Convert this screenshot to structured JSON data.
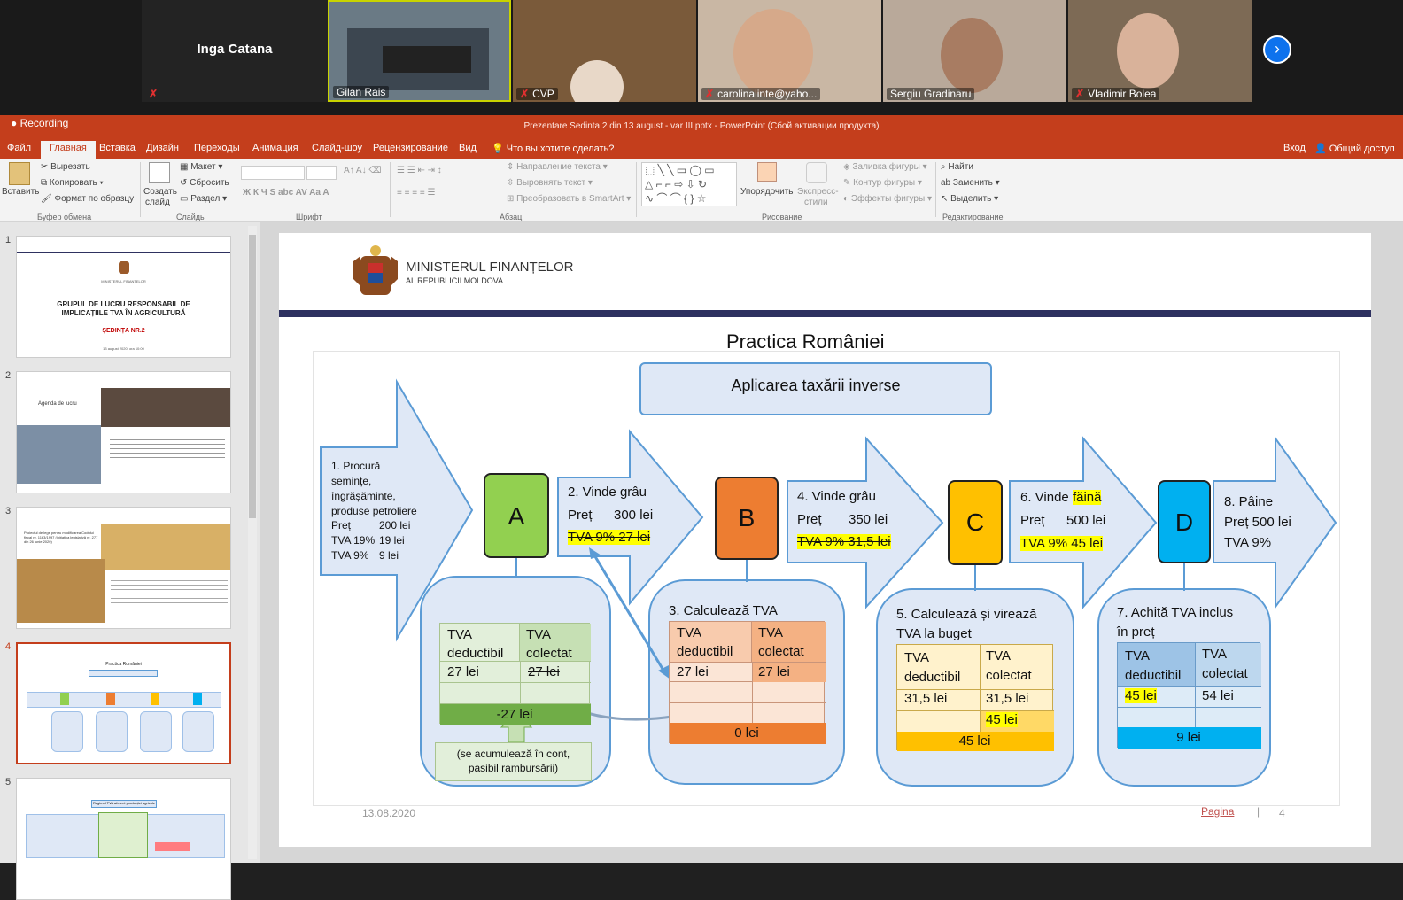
{
  "zoom": {
    "participants": [
      {
        "name": "Inga Catana"
      },
      {
        "name": "Gilan Rais"
      },
      {
        "name": "CVP"
      },
      {
        "name": "carolinalinte@yaho..."
      },
      {
        "name": "Sergiu Gradinaru"
      },
      {
        "name": "Vladimir Bolea"
      }
    ],
    "next_icon": "chevron-right-icon"
  },
  "titlebar": {
    "recording": "Recording",
    "title": "Prezentare Sedinta 2 din 13 august - var III.pptx - PowerPoint (Сбой активации продукта)"
  },
  "menu": {
    "items": [
      "Файл",
      "Главная",
      "Вставка",
      "Дизайн",
      "Переходы",
      "Анимация",
      "Слайд-шоу",
      "Рецензирование",
      "Вид"
    ],
    "tell": "Что вы хотите сделать?",
    "login": "Вход",
    "share": "Общий доступ"
  },
  "ribbon": {
    "paste": "Вставить",
    "cut": "Вырезать",
    "copy": "Копировать",
    "format_painter": "Формат по образцу",
    "clipboard": "Буфер обмена",
    "new_slide_1": "Создать",
    "new_slide_2": "слайд",
    "layout": "Макет",
    "reset": "Сбросить",
    "section": "Раздел",
    "slides": "Слайды",
    "font": "Шрифт",
    "text_direction": "Направление текста",
    "align_text": "Выровнять текст",
    "smartart": "Преобразовать в SmartArt",
    "paragraph": "Абзац",
    "arrange": "Упорядочить",
    "quick_styles_1": "Экспресс-",
    "quick_styles_2": "стили",
    "fill": "Заливка фигуры",
    "outline": "Контур фигуры",
    "effects": "Эффекты фигуры",
    "drawing": "Рисование",
    "find": "Найти",
    "replace": "Заменить",
    "select": "Выделить",
    "editing": "Редактирование"
  },
  "thumbs": [
    {
      "num": "1",
      "line1": "MINISTERUL FINANȚELOR",
      "line2": "GRUPUL DE LUCRU RESPONSABIL DE",
      "line3": "IMPLICAȚIILE TVA ÎN AGRICULTURĂ",
      "line4": "ȘEDINȚA NR.2",
      "line5": "13 august 2020, ora 10:00"
    },
    {
      "num": "2",
      "title": "Agenda de lucru"
    },
    {
      "num": "3",
      "title": "Proiectul de lege pentru modificarea Codului fiscal nr. 1163/1997 (inițiativa legislativă nr. 277 din 26 iunie 2020)"
    },
    {
      "num": "4",
      "title": "Practica României"
    },
    {
      "num": "5",
      "title": "Regimul TVA aferent producției agricole"
    }
  ],
  "slide": {
    "org1": "MINISTERUL FINANȚELOR",
    "org2": "AL REPUBLICII MOLDOVA",
    "title": "Practica României",
    "banner": "Aplicarea taxării inverse",
    "step1": [
      "1.    Procură",
      "semințe,",
      "îngrășăminte,",
      "produse petroliere"
    ],
    "step1_prices": [
      {
        "label": "Preț",
        "value": "200 lei"
      },
      {
        "label": "TVA 19%",
        "value": "19 lei"
      },
      {
        "label": "TVA 9%",
        "value": "9 lei"
      }
    ],
    "nodes": [
      "A",
      "B",
      "C",
      "D"
    ],
    "step2": {
      "title": "2. Vinde grâu",
      "price_label": "Preț",
      "price_value": "300 lei",
      "vat": "TVA 9% 27 lei"
    },
    "step4": {
      "title": "4. Vinde grâu",
      "price_label": "Preț",
      "price_value": "350 lei",
      "vat": "TVA 9% 31,5 lei"
    },
    "step6": {
      "title": "6. Vinde",
      "title_hl": "făină",
      "price_label": "Preț",
      "price_value": "500 lei",
      "vat": "TVA 9% 45 lei"
    },
    "step8": {
      "title": "8.      Pâine",
      "price": "Preț 500 lei",
      "vat": "TVA 9%"
    },
    "boxA": {
      "h1": "TVA deductibil",
      "h2": "TVA colectat",
      "v1": "27 lei",
      "v2": "27 lei",
      "total": "-27 lei",
      "note": "(se acumulează în cont, pasibil rambursării)"
    },
    "boxB": {
      "title": "3. Calculează TVA",
      "h1": "TVA deductibil",
      "h2": "TVA colectat",
      "v1": "27 lei",
      "v2": "27 lei",
      "total": "0 lei"
    },
    "boxC": {
      "title1": "5. Calculează și virează",
      "title2": "TVA la buget",
      "h1": "TVA deductibil",
      "h2": "TVA colectat",
      "v1": "31,5 lei",
      "v2": "31,5 lei",
      "v3": "45 lei",
      "total": "45 lei"
    },
    "boxD": {
      "title1": "7. Achită TVA inclus",
      "title2": "în preț",
      "h1": "TVA deductibil",
      "h2": "TVA colectat",
      "v1": "45 lei",
      "v2": "54 lei",
      "total": "9 lei"
    },
    "footer_date": "13.08.2020",
    "footer_page_label": "Pagina",
    "footer_page_num": "4"
  },
  "colors": {
    "green": "#92d050",
    "orange": "#ed7d31",
    "yellow": "#ffc000",
    "blue": "#00b0f0",
    "arrow_fill": "#dfe8f6",
    "arrow_stroke": "#5b9bd5",
    "highlight": "#ffff00",
    "ppt_red": "#c43e1c"
  }
}
